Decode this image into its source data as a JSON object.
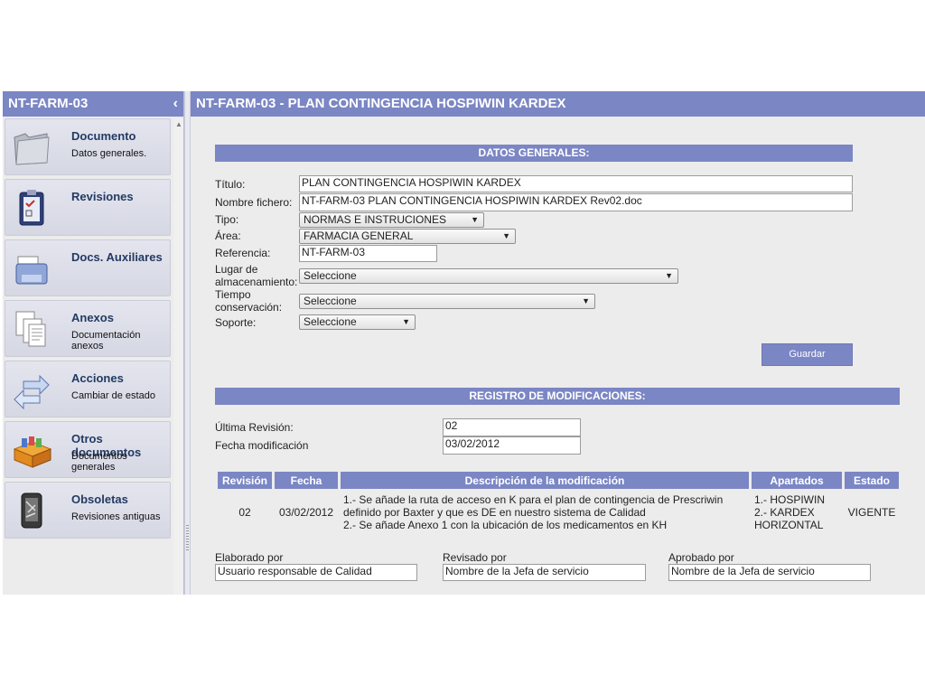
{
  "sidebar": {
    "title": "NT-FARM-03",
    "collapse_glyph": "‹",
    "items": [
      {
        "title": "Documento",
        "subtitle": "Datos generales.",
        "icon": "folder-icon"
      },
      {
        "title": "Revisiones",
        "subtitle": "",
        "icon": "clipboard-icon"
      },
      {
        "title": "Docs. Auxiliares",
        "subtitle": "",
        "icon": "printer-icon"
      },
      {
        "title": "Anexos",
        "subtitle": "Documentación anexos",
        "icon": "documents-icon"
      },
      {
        "title": "Acciones",
        "subtitle": "Cambiar de estado",
        "icon": "arrows-icon"
      },
      {
        "title": "Otros documentos",
        "subtitle": "Documentos generales",
        "icon": "file-box-icon"
      },
      {
        "title": "Obsoletas",
        "subtitle": "Revisiones antiguas",
        "icon": "shredder-icon"
      }
    ]
  },
  "main": {
    "title": "NT-FARM-03 - PLAN CONTINGENCIA HOSPIWIN KARDEX",
    "datos_generales": {
      "heading": "DATOS GENERALES:",
      "titulo_label": "Título:",
      "titulo_value": "PLAN CONTINGENCIA HOSPIWIN KARDEX",
      "nombre_label": "Nombre fichero:",
      "nombre_value": "NT-FARM-03 PLAN CONTINGENCIA HOSPIWIN KARDEX Rev02.doc",
      "tipo_label": "Tipo:",
      "tipo_value": "NORMAS E INSTRUCIONES",
      "area_label": "Área:",
      "area_value": "FARMACIA GENERAL",
      "referencia_label": "Referencia:",
      "referencia_value": "NT-FARM-03",
      "lugar_label_1": "Lugar de",
      "lugar_label_2": "almacenamiento:",
      "lugar_value": "Seleccione",
      "tiempo_label_1": "Tiempo",
      "tiempo_label_2": "conservación:",
      "tiempo_value": "Seleccione",
      "soporte_label": "Soporte:",
      "soporte_value": "Seleccione",
      "save_label": "Guardar"
    },
    "registro": {
      "heading": "REGISTRO DE MODIFICACIONES:",
      "ultima_label": "Última Revisión:",
      "ultima_value": "02",
      "fecha_label": "Fecha modificación",
      "fecha_value": "03/02/2012",
      "columns": [
        "Revisión",
        "Fecha",
        "Descripción de la modificación",
        "Apartados",
        "Estado"
      ],
      "rows": [
        {
          "revision": "02",
          "fecha": "03/02/2012",
          "descripcion": [
            "1.- Se añade la ruta de acceso en K para el plan de contingencia de Prescriwin",
            "definido por Baxter y que es DE en nuestro sistema de Calidad",
            "2.- Se añade Anexo 1 con la ubicación de los medicamentos en KH"
          ],
          "apartados": [
            "1.- HOSPIWIN",
            "2.- KARDEX",
            "HORIZONTAL"
          ],
          "estado": "VIGENTE"
        }
      ]
    },
    "firmas": {
      "elaborado_label": "Elaborado por",
      "elaborado_value": "Usuario responsable de Calidad",
      "revisado_label": "Revisado por",
      "revisado_value": "Nombre de la Jefa de servicio",
      "aprobado_label": "Aprobado por",
      "aprobado_value": "Nombre de la Jefa de servicio"
    }
  },
  "colors": {
    "accent": "#7b86c4",
    "panel_bg": "#ececec"
  }
}
